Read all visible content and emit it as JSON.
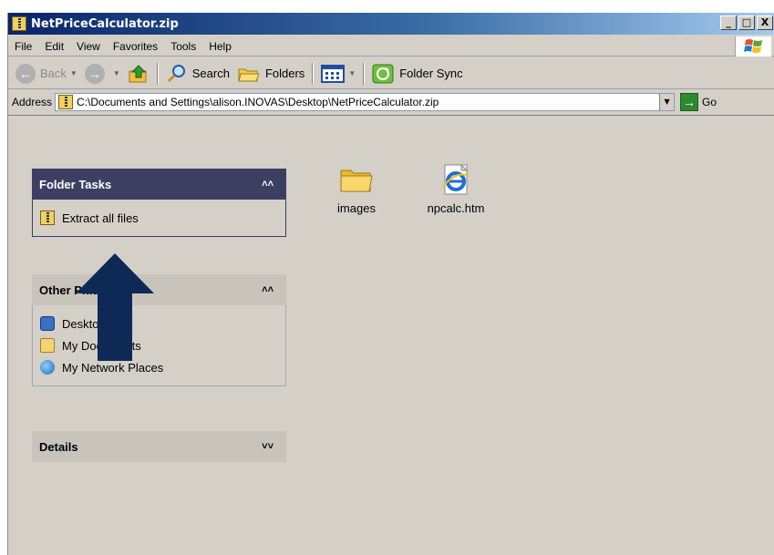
{
  "window": {
    "title": "NetPriceCalculator.zip",
    "controls": {
      "minimize": "_",
      "maximize": "□",
      "close": "X"
    }
  },
  "menu": {
    "items": [
      "File",
      "Edit",
      "View",
      "Favorites",
      "Tools",
      "Help"
    ]
  },
  "toolbar": {
    "back_label": "Back",
    "search_label": "Search",
    "folders_label": "Folders",
    "folder_sync_label": "Folder Sync"
  },
  "address": {
    "label": "Address",
    "value": "C:\\Documents and Settings\\alison.INOVAS\\Desktop\\NetPriceCalculator.zip",
    "go_label": "Go"
  },
  "panels": {
    "folder_tasks": {
      "title": "Folder Tasks",
      "items": [
        {
          "label": "Extract all files",
          "icon": "zip-icon"
        }
      ]
    },
    "other_places": {
      "title": "Other Places",
      "items": [
        {
          "label": "Desktop",
          "icon": "desktop-icon"
        },
        {
          "label": "My Documents",
          "icon": "my-documents-icon"
        },
        {
          "label": "My Network Places",
          "icon": "network-places-icon"
        }
      ]
    },
    "details": {
      "title": "Details"
    }
  },
  "files": [
    {
      "name": "images",
      "icon": "folder-icon"
    },
    {
      "name": "npcalc.htm",
      "icon": "internet-explorer-icon"
    }
  ],
  "annotation": {
    "color": "#0d2a57",
    "direction": "up"
  }
}
